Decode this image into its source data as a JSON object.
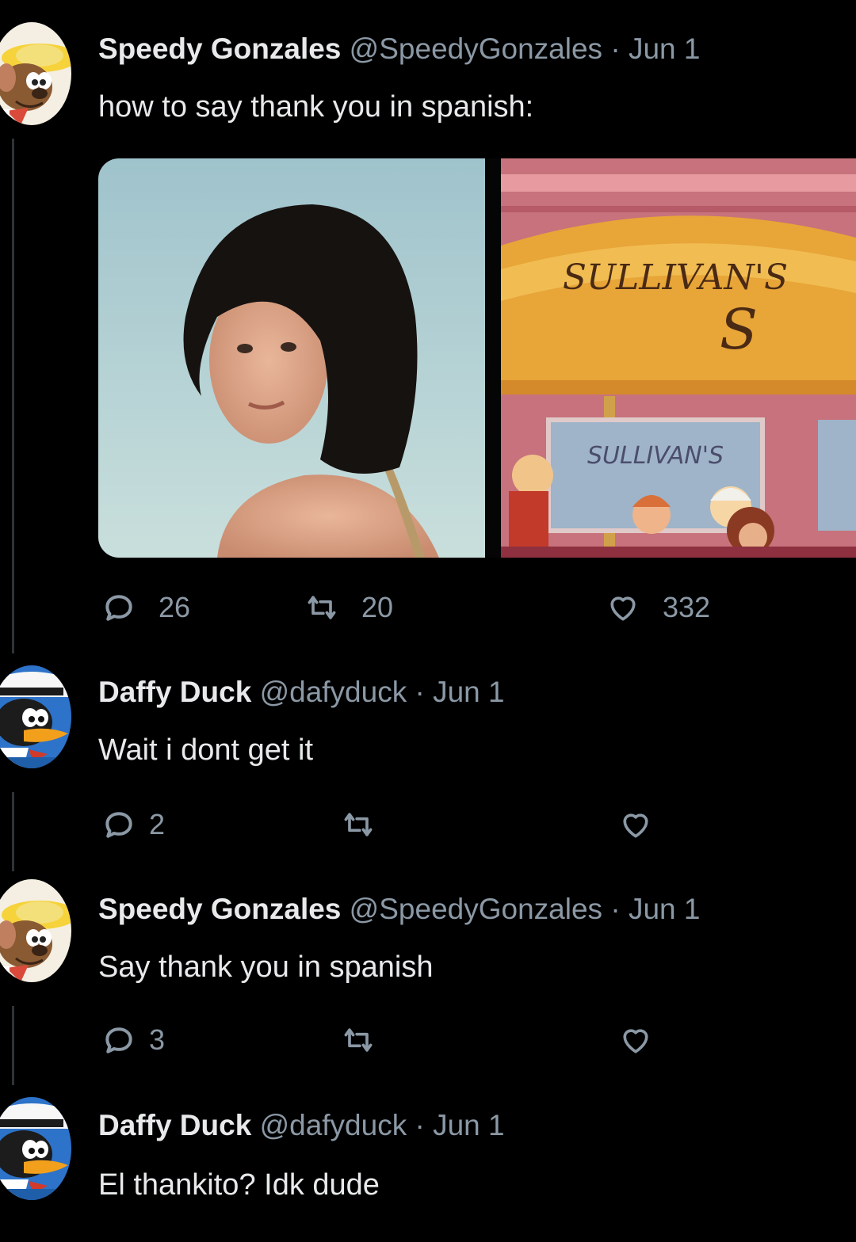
{
  "tweets": [
    {
      "author": "Speedy Gonzales",
      "handle": "@SpeedyGonzales",
      "separator": "·",
      "date": "Jun 1",
      "text": "how to say thank you in spanish:",
      "avatar_icon": "speedy-gonzales-avatar",
      "media": {
        "left_image": "photo-woman-short-dark-hair",
        "right_image": "cartoon-storefront-sullivans",
        "sign_text": "SULLIVAN'S",
        "sign_letter": "S",
        "window_text": "SULLIVAN'S"
      },
      "replies": "26",
      "retweets": "20",
      "likes": "332"
    },
    {
      "author": "Daffy Duck",
      "handle": "@dafyduck",
      "separator": "·",
      "date": "Jun 1",
      "text": "Wait i dont get it",
      "avatar_icon": "daffy-duck-avatar",
      "replies": "2"
    },
    {
      "author": "Speedy Gonzales",
      "handle": "@SpeedyGonzales",
      "separator": "·",
      "date": "Jun 1",
      "text": "Say thank you in spanish",
      "avatar_icon": "speedy-gonzales-avatar",
      "replies": "3"
    },
    {
      "author": "Daffy Duck",
      "handle": "@dafyduck",
      "separator": "·",
      "date": "Jun 1",
      "text": "El thankito? Idk dude",
      "avatar_icon": "daffy-duck-avatar"
    }
  ],
  "colors": {
    "background": "#000000",
    "text": "#e7e9ea",
    "secondary": "#8b98a5",
    "thread_line": "#2f3336"
  }
}
